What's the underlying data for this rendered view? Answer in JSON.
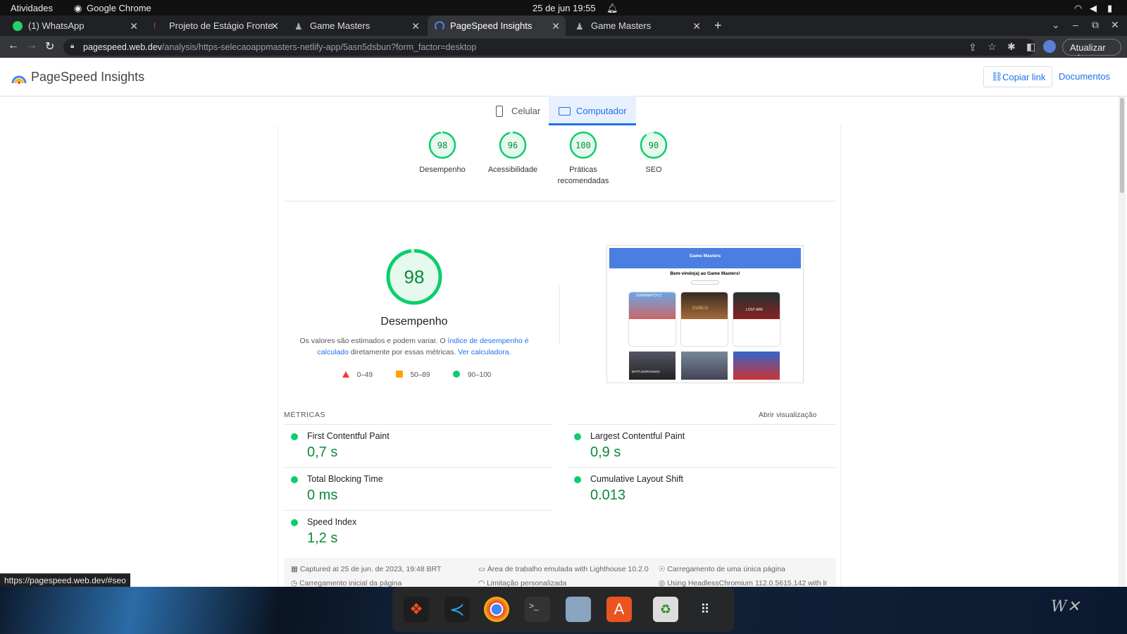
{
  "os": {
    "activities": "Atividades",
    "app_name": "Google Chrome",
    "clock": "25 de jun  19:55"
  },
  "browser": {
    "tabs": [
      {
        "label": "(1) WhatsApp"
      },
      {
        "label": "Projeto de Estágio Fronte"
      },
      {
        "label": "Game Masters"
      },
      {
        "label": "PageSpeed Insights"
      },
      {
        "label": "Game Masters"
      }
    ],
    "url_host": "pagespeed.web.dev",
    "url_path": "/analysis/https-selecaoappmasters-netlify-app/5asn5dsbun?form_factor=desktop",
    "update_label": "Atualizar",
    "status_url": "https://pagespeed.web.dev/#seo"
  },
  "header": {
    "title": "PageSpeed Insights",
    "copy_link": "Copiar link",
    "docs": "Documentos"
  },
  "device_tabs": {
    "mobile": "Celular",
    "desktop": "Computador"
  },
  "scores": [
    {
      "value": "98",
      "label": "Desempenho",
      "fraction": 0.98
    },
    {
      "value": "96",
      "label": "Acessibilidade",
      "fraction": 0.96
    },
    {
      "value": "100",
      "label": "Práticas recomendadas",
      "fraction": 1.0
    },
    {
      "value": "90",
      "label": "SEO",
      "fraction": 0.9
    }
  ],
  "performance": {
    "score": "98",
    "title": "Desempenho",
    "desc_1": "Os valores são estimados e podem variar. O ",
    "desc_link1": "índice de desempenho é calculado",
    "desc_2": " diretamente por essas métricas. ",
    "desc_link2": "Ver calculadora.",
    "legend": [
      "0–49",
      "50–89",
      "90–100"
    ]
  },
  "preview": {
    "site_name": "Game Masters",
    "welcome": "Bem-vindo(a) ao Game Masters!",
    "cards": [
      "OVERWATCH 2",
      "DIABLO",
      "LOST ARK",
      "BATTLEGROUNDS",
      "",
      ""
    ]
  },
  "metrics": {
    "heading": "MÉTRICAS",
    "expand": "Abrir visualização",
    "items": [
      {
        "name": "First Contentful Paint",
        "value": "0,7 s"
      },
      {
        "name": "Largest Contentful Paint",
        "value": "0,9 s"
      },
      {
        "name": "Total Blocking Time",
        "value": "0 ms"
      },
      {
        "name": "Cumulative Layout Shift",
        "value": "0.013"
      },
      {
        "name": "Speed Index",
        "value": "1,2 s"
      }
    ]
  },
  "footer": {
    "captured": "Captured at 25 de jun. de 2023, 19:48 BRT",
    "emulated": "Área de trabalho emulada with Lighthouse 10.2.0",
    "single_load": "Carregamento de uma única página",
    "initial_load": "Carregamento inicial da página",
    "throttling": "Limitação personalizada",
    "chromium": "Using HeadlessChromium 112.0.5615.142 with lr"
  }
}
